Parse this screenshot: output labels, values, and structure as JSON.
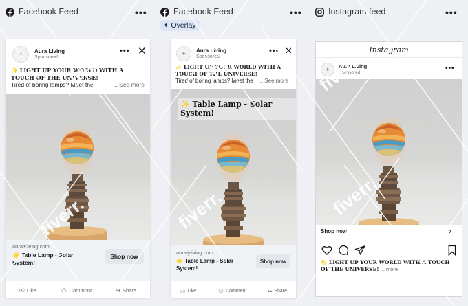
{
  "columns": [
    {
      "platform": "facebook",
      "label": "Facebook Feed"
    },
    {
      "platform": "facebook",
      "label": "Facebook Feed"
    },
    {
      "platform": "instagram",
      "label": "Instagram feed"
    }
  ],
  "overlay_chip": "Overlay",
  "post": {
    "brand": "Aura Living",
    "sponsored": "Sponsored",
    "headline": "✨ LIGHT UP YOUR WORLD WITH A TOUCH OF THE UNIVERSE!",
    "body": "Tired of boring lamps? Meet the",
    "see_more": "...See more",
    "url": "auralyliving.com",
    "product_title": "🌟 Table Lamp - Solar System!",
    "cta": "Shop now",
    "overlay_text": "✨ Table Lamp - Solar System!",
    "actions": {
      "like": "Like",
      "comment": "Comment",
      "share": "Share"
    }
  },
  "instagram": {
    "wordmark": "Instagram",
    "cta": "Shop now",
    "caption": "🌟 LIGHT UP YOUR WORLD WITH A TOUCH OF THE UNIVERSE!",
    "more": "... more"
  },
  "watermark": "fiverr.",
  "colors": {
    "facebook_blue": "#1877f2",
    "chip_bg": "#dde6f5",
    "cta_bg": "#e4e6eb"
  }
}
